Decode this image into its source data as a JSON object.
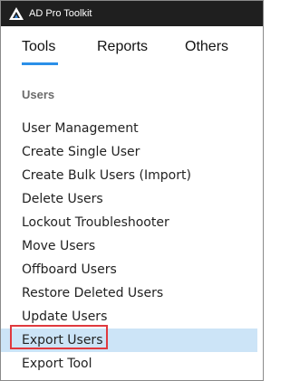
{
  "window": {
    "title": "AD Pro Toolkit",
    "logo_icon": "ad-pro-logo-icon"
  },
  "tabs": [
    {
      "label": "Tools",
      "active": true
    },
    {
      "label": "Reports",
      "active": false
    },
    {
      "label": "Others",
      "active": false
    }
  ],
  "section": {
    "heading": "Users"
  },
  "menu": {
    "items": [
      {
        "label": "User Management"
      },
      {
        "label": "Create Single User"
      },
      {
        "label": "Create Bulk Users (Import)"
      },
      {
        "label": "Delete Users"
      },
      {
        "label": "Lockout Troubleshooter"
      },
      {
        "label": "Move Users"
      },
      {
        "label": "Offboard Users"
      },
      {
        "label": "Restore Deleted Users"
      },
      {
        "label": "Update Users"
      },
      {
        "label": "Export Users",
        "selected": true
      },
      {
        "label": "Export Tool"
      }
    ]
  },
  "colors": {
    "titlebar": "#1f1f1f",
    "tab_indicator": "#2b8fe8",
    "selected_row": "#cce4f7",
    "highlight_box": "#e0393e"
  }
}
